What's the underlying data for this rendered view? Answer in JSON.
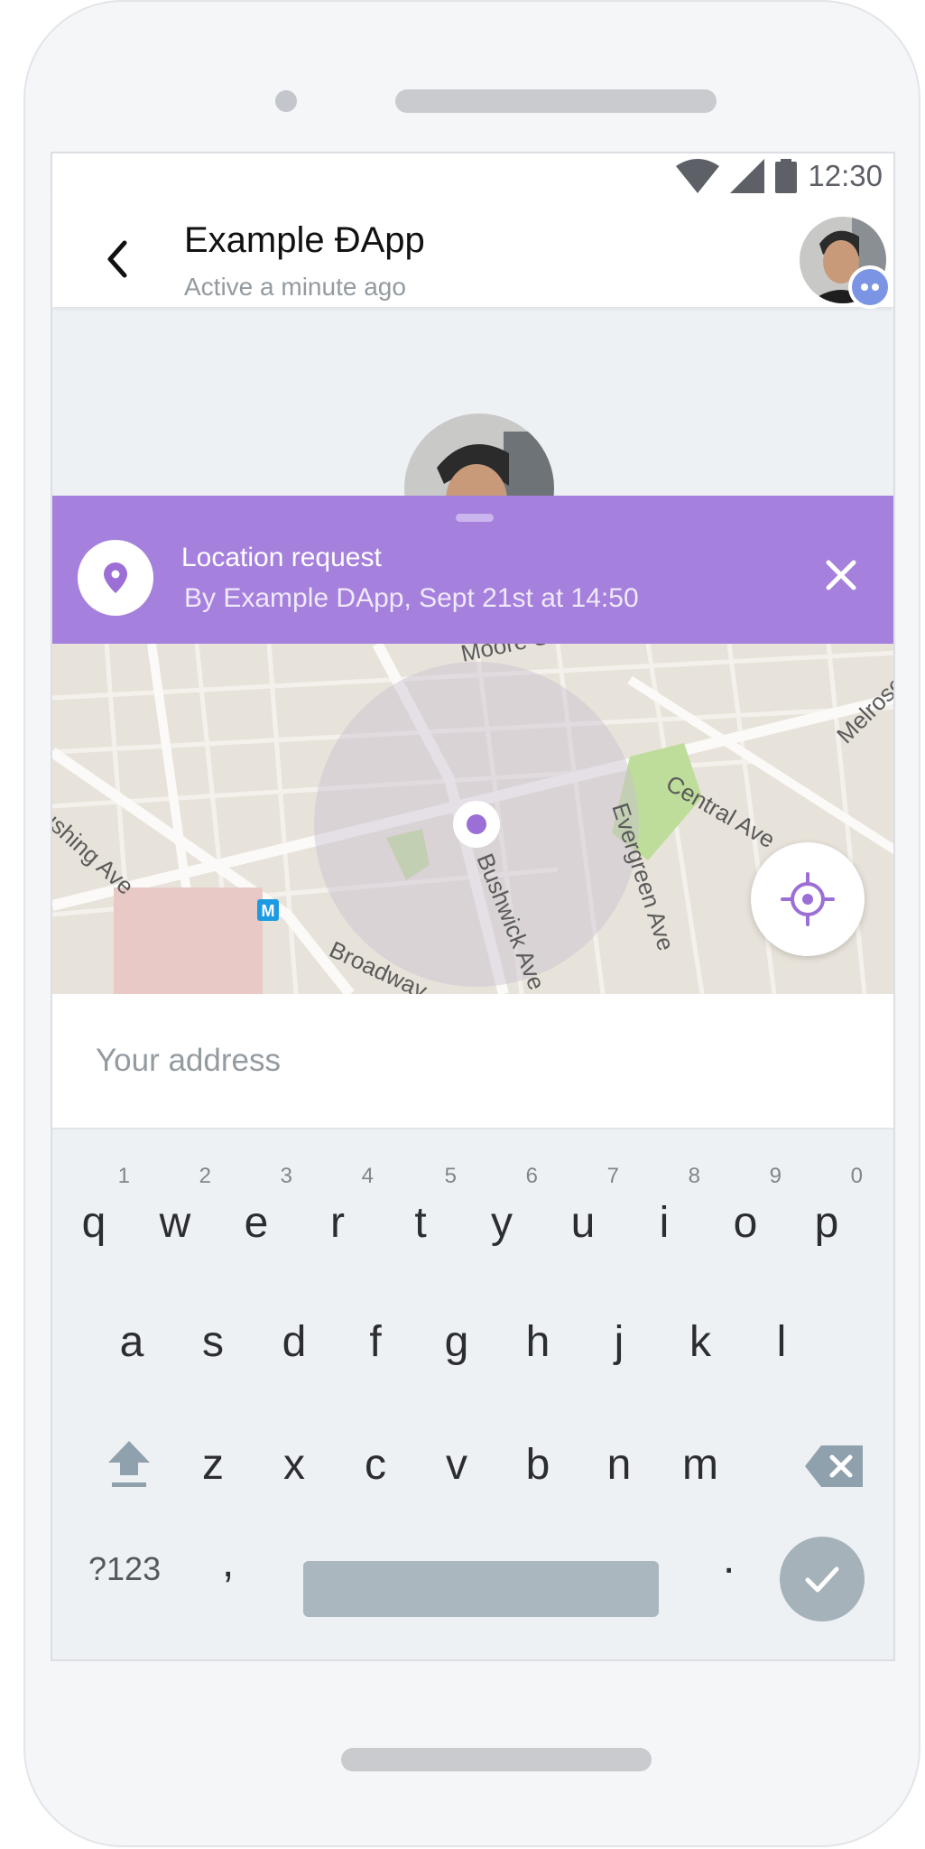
{
  "status_bar": {
    "time": "12:30",
    "icons": [
      "wifi-icon",
      "cellular-signal-icon",
      "battery-icon"
    ]
  },
  "header": {
    "title": "Example ĐApp",
    "subtitle": "Active a minute ago"
  },
  "location_request": {
    "title": "Location request",
    "subtitle": "By Example DApp, Sept  21st at 14:50"
  },
  "map": {
    "streets": [
      "Moore St",
      "Central Ave",
      "Melrose St",
      "Evergreen Ave",
      "Bushwick Ave",
      "Broadway",
      "Flushing Ave"
    ],
    "transit_label": "M"
  },
  "address_input": {
    "placeholder": "Your address",
    "value": ""
  },
  "keyboard": {
    "row1": [
      {
        "key": "q",
        "hint": "1"
      },
      {
        "key": "w",
        "hint": "2"
      },
      {
        "key": "e",
        "hint": "3"
      },
      {
        "key": "r",
        "hint": "4"
      },
      {
        "key": "t",
        "hint": "5"
      },
      {
        "key": "y",
        "hint": "6"
      },
      {
        "key": "u",
        "hint": "7"
      },
      {
        "key": "i",
        "hint": "8"
      },
      {
        "key": "o",
        "hint": "9"
      },
      {
        "key": "p",
        "hint": "0"
      }
    ],
    "row2": [
      "a",
      "s",
      "d",
      "f",
      "g",
      "h",
      "j",
      "k",
      "l"
    ],
    "row3": [
      "z",
      "x",
      "c",
      "v",
      "b",
      "n",
      "m"
    ],
    "symbols_label": "?123",
    "comma": ",",
    "period": "."
  },
  "colors": {
    "accent": "#a580dd",
    "accent_icon": "#9b6fd6",
    "badge": "#7b95e4",
    "map_circle": "#c9bfd0"
  }
}
